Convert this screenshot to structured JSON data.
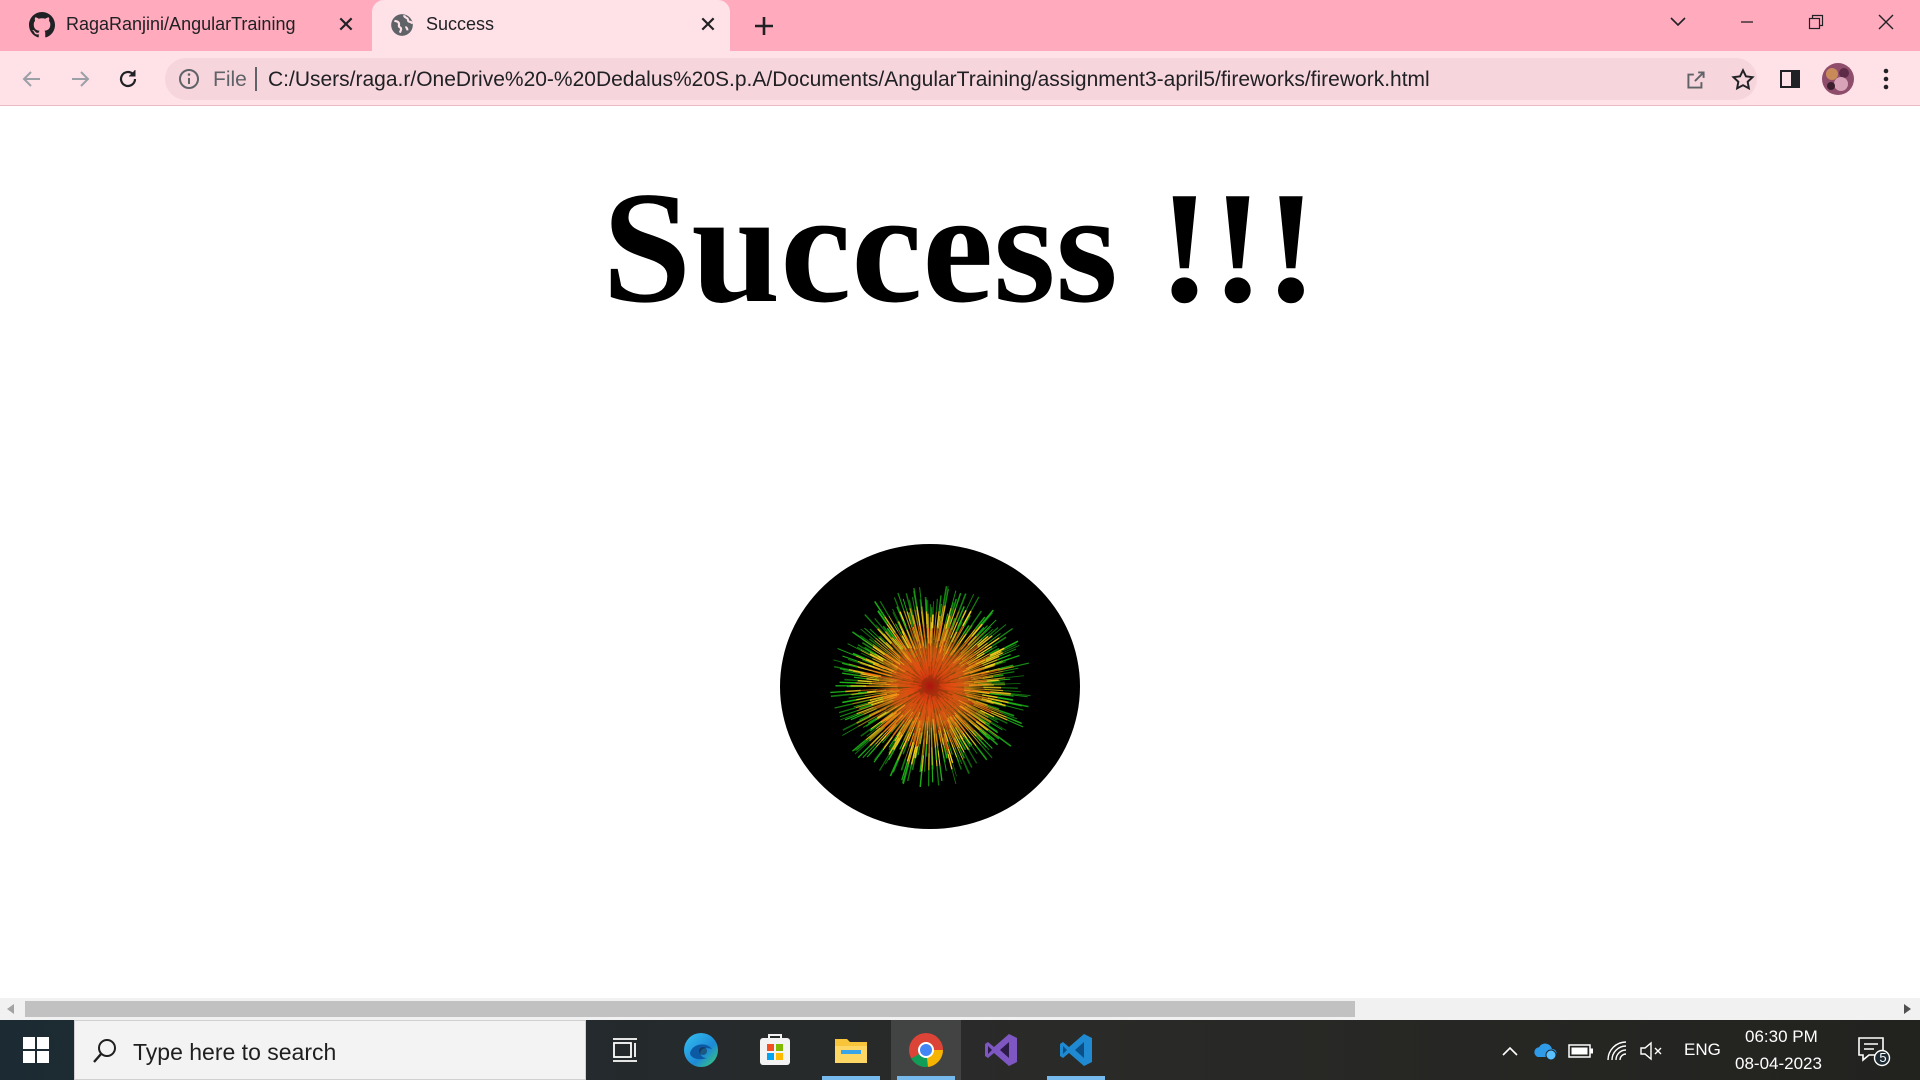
{
  "browser": {
    "tabs": [
      {
        "label": "RagaRanjini/AngularTraining",
        "icon": "github-icon",
        "active": false
      },
      {
        "label": "Success",
        "icon": "globe-icon",
        "active": true
      }
    ],
    "address": {
      "scheme_label": "File",
      "url": "C:/Users/raga.r/OneDrive%20-%20Dedalus%20S.p.A/Documents/AngularTraining/assignment3-april5/fireworks/firework.html"
    },
    "colors": {
      "tabstrip": "#ffabbd",
      "toolbar": "#ffe1e8",
      "omnibox": "#f7d5dd"
    }
  },
  "page": {
    "heading": "Success !!!",
    "firework_colors": [
      "#000000",
      "#1db318",
      "#f4d21c",
      "#ff7a12",
      "#c2140f"
    ]
  },
  "taskbar": {
    "search_placeholder": "Type here to search",
    "apps": [
      "task-view-icon",
      "edge-icon",
      "store-icon",
      "file-explorer-icon",
      "chrome-icon",
      "visual-studio-icon",
      "vscode-icon"
    ],
    "tray": {
      "language": "ENG",
      "time": "06:30 PM",
      "date": "08-04-2023",
      "notification_count": "5"
    }
  }
}
